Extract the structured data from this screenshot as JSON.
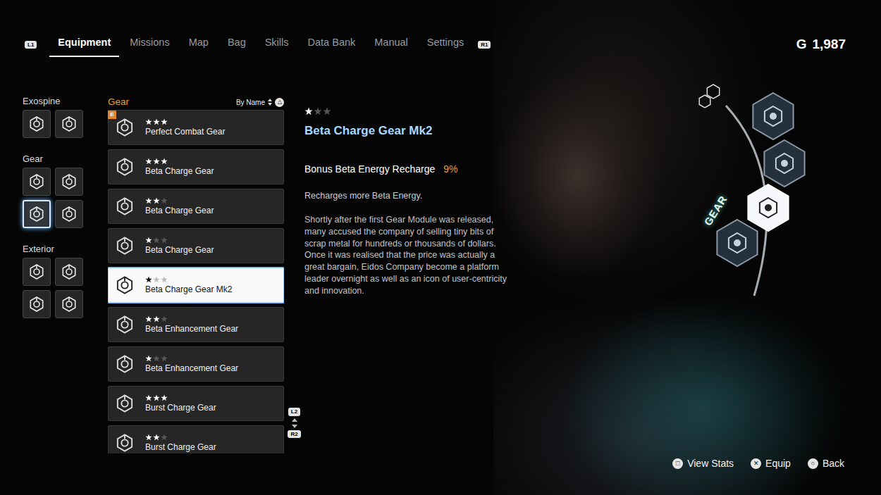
{
  "nav": {
    "left_key": "L1",
    "right_key": "R1",
    "tabs": [
      {
        "label": "Equipment",
        "selected": true
      },
      {
        "label": "Missions",
        "selected": false
      },
      {
        "label": "Map",
        "selected": false
      },
      {
        "label": "Bag",
        "selected": false
      },
      {
        "label": "Skills",
        "selected": false
      },
      {
        "label": "Data Bank",
        "selected": false
      },
      {
        "label": "Manual",
        "selected": false
      },
      {
        "label": "Settings",
        "selected": false
      }
    ]
  },
  "currency": {
    "symbol": "G",
    "amount": "1,987"
  },
  "slots": {
    "groups": [
      {
        "label": "Exospine",
        "items": [
          {
            "selected": false
          },
          {
            "selected": false
          }
        ]
      },
      {
        "label": "Gear",
        "items": [
          {
            "selected": false
          },
          {
            "selected": false
          },
          {
            "selected": true
          },
          {
            "selected": false
          }
        ]
      },
      {
        "label": "Exterior",
        "items": [
          {
            "selected": false
          },
          {
            "selected": false
          },
          {
            "selected": false
          },
          {
            "selected": false
          }
        ]
      }
    ]
  },
  "gear_list": {
    "title": "Gear",
    "sort_label": "By Name",
    "sort_key": "△",
    "equipped_badge": "E",
    "scroll_keys": [
      "L2",
      "R2"
    ],
    "items": [
      {
        "name": "Perfect Combat Gear",
        "stars": 3,
        "selected": false,
        "equipped": true
      },
      {
        "name": "Beta Charge Gear",
        "stars": 3,
        "selected": false,
        "equipped": false
      },
      {
        "name": "Beta Charge Gear",
        "stars": 2,
        "selected": false,
        "equipped": false
      },
      {
        "name": "Beta Charge Gear",
        "stars": 1,
        "selected": false,
        "equipped": false
      },
      {
        "name": "Beta Charge Gear Mk2",
        "stars": 1,
        "selected": true,
        "equipped": false
      },
      {
        "name": "Beta Enhancement Gear",
        "stars": 2,
        "selected": false,
        "equipped": false
      },
      {
        "name": "Beta Enhancement Gear",
        "stars": 1,
        "selected": false,
        "equipped": false
      },
      {
        "name": "Burst Charge Gear",
        "stars": 3,
        "selected": false,
        "equipped": false
      },
      {
        "name": "Burst Charge Gear",
        "stars": 2,
        "selected": false,
        "equipped": false
      }
    ]
  },
  "detail": {
    "stars": 1,
    "name": "Beta Charge Gear Mk2",
    "stat_label": "Bonus Beta Energy Recharge",
    "stat_value": "9%",
    "summary": "Recharges more Beta Energy.",
    "lore": "Shortly after the first Gear Module was released, many accused the company of selling tiny bits of scrap metal for hundreds or thousands of dollars. Once it was realised that the price was actually a great bargain, Eidos Company become a platform leader overnight as well as an icon of user-centricity and innovation."
  },
  "portrait": {
    "ring_label": "GEAR",
    "slots": [
      {
        "selected": false
      },
      {
        "selected": false
      },
      {
        "selected": true
      },
      {
        "selected": false
      }
    ]
  },
  "buttons": [
    {
      "glyph": "□",
      "label": "View Stats"
    },
    {
      "glyph": "✕",
      "label": "Equip"
    },
    {
      "glyph": "○",
      "label": "Back"
    }
  ]
}
